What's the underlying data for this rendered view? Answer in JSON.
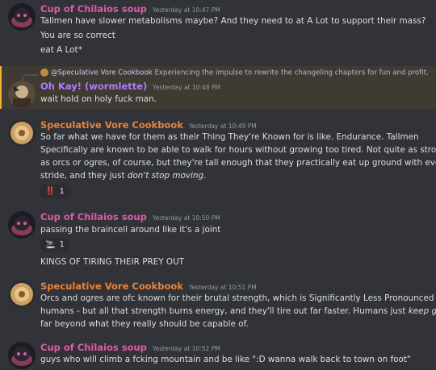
{
  "colors": {
    "pink_name": "#e05aa8",
    "purple_name": "#b07bff",
    "orange_name": "#e8833a",
    "highlight_bg": "#3f3b32",
    "highlight_bar": "#f0b232"
  },
  "messages": [
    {
      "author": "Cup of Chilaios soup",
      "time": "Yesterday at 10:47 PM",
      "lines": [
        "Tallmen have slower metabolisms maybe? And they need to at A Lot to support their mass?",
        "You are so correct",
        "eat A Lot*"
      ]
    },
    {
      "reply_to": "@Speculative Vore Cookbook",
      "reply_text": "Experiencing the impulse to rewrite the changeling chapters for fun and profit.",
      "author": "Oh Kay! (wormlette)",
      "time": "Yesterday at 10:48 PM",
      "lines": [
        "wait hold on holy fuck man."
      ]
    },
    {
      "author": "Speculative Vore Cookbook",
      "time": "Yesterday at 10:49 PM",
      "lines": [
        "So far what we have for them as their Thing They're Known for is like. Endurance. Tallmen",
        "Specifically are known to be able to walk for hours without growing too tired. Not quite as strong",
        "as orcs or ogres, of course, but they're tall enough that they practically eat up ground with every",
        "stride, and they just "
      ],
      "italic_tail": "don't stop moving",
      "tail_end": ".",
      "reaction": {
        "emoji": "‼️",
        "count": "1"
      }
    },
    {
      "author": "Cup of Chilaios soup",
      "time": "Yesterday at 10:50 PM",
      "lines": [
        "passing the braincell around like it's a joint"
      ],
      "reaction": {
        "emoji": "🚬",
        "count": "1"
      },
      "extra": "KINGS OF TIRING THEIR PREY OUT"
    },
    {
      "author": "Speculative Vore Cookbook",
      "time": "Yesterday at 10:51 PM",
      "lines": [
        "Orcs and ogres are ofc known for their brutal strength, which is Significantly Less Pronounced in",
        "humans - but all that strength burns energy, and they'll tire out far faster. Humans just "
      ],
      "italic_tail": "keep going",
      "tail_end": ",",
      "line3": "far beyond what they really should be capable of."
    },
    {
      "author": "Cup of Chilaios soup",
      "time": "Yesterday at 10:52 PM",
      "lines": [
        "guys who will climb a fcking mountain and be like \":D wanna walk back to town on foot\""
      ]
    }
  ]
}
